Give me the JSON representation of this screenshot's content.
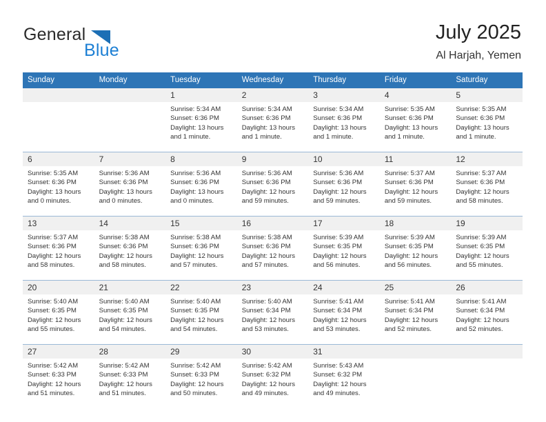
{
  "brand": {
    "name_part1": "General",
    "name_part2": "Blue",
    "triangle_color": "#1c6fb5",
    "blue_color": "#1c7fd4"
  },
  "header": {
    "title": "July 2025",
    "location": "Al Harjah, Yemen",
    "header_bg": "#2e75b6",
    "daynum_bg": "#f0f0f0"
  },
  "weekday_headers": [
    "Sunday",
    "Monday",
    "Tuesday",
    "Wednesday",
    "Thursday",
    "Friday",
    "Saturday"
  ],
  "weeks": [
    [
      {
        "day": "",
        "lines": []
      },
      {
        "day": "",
        "lines": []
      },
      {
        "day": "1",
        "lines": [
          "Sunrise: 5:34 AM",
          "Sunset: 6:36 PM",
          "Daylight: 13 hours",
          "and 1 minute."
        ]
      },
      {
        "day": "2",
        "lines": [
          "Sunrise: 5:34 AM",
          "Sunset: 6:36 PM",
          "Daylight: 13 hours",
          "and 1 minute."
        ]
      },
      {
        "day": "3",
        "lines": [
          "Sunrise: 5:34 AM",
          "Sunset: 6:36 PM",
          "Daylight: 13 hours",
          "and 1 minute."
        ]
      },
      {
        "day": "4",
        "lines": [
          "Sunrise: 5:35 AM",
          "Sunset: 6:36 PM",
          "Daylight: 13 hours",
          "and 1 minute."
        ]
      },
      {
        "day": "5",
        "lines": [
          "Sunrise: 5:35 AM",
          "Sunset: 6:36 PM",
          "Daylight: 13 hours",
          "and 1 minute."
        ]
      }
    ],
    [
      {
        "day": "6",
        "lines": [
          "Sunrise: 5:35 AM",
          "Sunset: 6:36 PM",
          "Daylight: 13 hours",
          "and 0 minutes."
        ]
      },
      {
        "day": "7",
        "lines": [
          "Sunrise: 5:36 AM",
          "Sunset: 6:36 PM",
          "Daylight: 13 hours",
          "and 0 minutes."
        ]
      },
      {
        "day": "8",
        "lines": [
          "Sunrise: 5:36 AM",
          "Sunset: 6:36 PM",
          "Daylight: 13 hours",
          "and 0 minutes."
        ]
      },
      {
        "day": "9",
        "lines": [
          "Sunrise: 5:36 AM",
          "Sunset: 6:36 PM",
          "Daylight: 12 hours",
          "and 59 minutes."
        ]
      },
      {
        "day": "10",
        "lines": [
          "Sunrise: 5:36 AM",
          "Sunset: 6:36 PM",
          "Daylight: 12 hours",
          "and 59 minutes."
        ]
      },
      {
        "day": "11",
        "lines": [
          "Sunrise: 5:37 AM",
          "Sunset: 6:36 PM",
          "Daylight: 12 hours",
          "and 59 minutes."
        ]
      },
      {
        "day": "12",
        "lines": [
          "Sunrise: 5:37 AM",
          "Sunset: 6:36 PM",
          "Daylight: 12 hours",
          "and 58 minutes."
        ]
      }
    ],
    [
      {
        "day": "13",
        "lines": [
          "Sunrise: 5:37 AM",
          "Sunset: 6:36 PM",
          "Daylight: 12 hours",
          "and 58 minutes."
        ]
      },
      {
        "day": "14",
        "lines": [
          "Sunrise: 5:38 AM",
          "Sunset: 6:36 PM",
          "Daylight: 12 hours",
          "and 58 minutes."
        ]
      },
      {
        "day": "15",
        "lines": [
          "Sunrise: 5:38 AM",
          "Sunset: 6:36 PM",
          "Daylight: 12 hours",
          "and 57 minutes."
        ]
      },
      {
        "day": "16",
        "lines": [
          "Sunrise: 5:38 AM",
          "Sunset: 6:36 PM",
          "Daylight: 12 hours",
          "and 57 minutes."
        ]
      },
      {
        "day": "17",
        "lines": [
          "Sunrise: 5:39 AM",
          "Sunset: 6:35 PM",
          "Daylight: 12 hours",
          "and 56 minutes."
        ]
      },
      {
        "day": "18",
        "lines": [
          "Sunrise: 5:39 AM",
          "Sunset: 6:35 PM",
          "Daylight: 12 hours",
          "and 56 minutes."
        ]
      },
      {
        "day": "19",
        "lines": [
          "Sunrise: 5:39 AM",
          "Sunset: 6:35 PM",
          "Daylight: 12 hours",
          "and 55 minutes."
        ]
      }
    ],
    [
      {
        "day": "20",
        "lines": [
          "Sunrise: 5:40 AM",
          "Sunset: 6:35 PM",
          "Daylight: 12 hours",
          "and 55 minutes."
        ]
      },
      {
        "day": "21",
        "lines": [
          "Sunrise: 5:40 AM",
          "Sunset: 6:35 PM",
          "Daylight: 12 hours",
          "and 54 minutes."
        ]
      },
      {
        "day": "22",
        "lines": [
          "Sunrise: 5:40 AM",
          "Sunset: 6:35 PM",
          "Daylight: 12 hours",
          "and 54 minutes."
        ]
      },
      {
        "day": "23",
        "lines": [
          "Sunrise: 5:40 AM",
          "Sunset: 6:34 PM",
          "Daylight: 12 hours",
          "and 53 minutes."
        ]
      },
      {
        "day": "24",
        "lines": [
          "Sunrise: 5:41 AM",
          "Sunset: 6:34 PM",
          "Daylight: 12 hours",
          "and 53 minutes."
        ]
      },
      {
        "day": "25",
        "lines": [
          "Sunrise: 5:41 AM",
          "Sunset: 6:34 PM",
          "Daylight: 12 hours",
          "and 52 minutes."
        ]
      },
      {
        "day": "26",
        "lines": [
          "Sunrise: 5:41 AM",
          "Sunset: 6:34 PM",
          "Daylight: 12 hours",
          "and 52 minutes."
        ]
      }
    ],
    [
      {
        "day": "27",
        "lines": [
          "Sunrise: 5:42 AM",
          "Sunset: 6:33 PM",
          "Daylight: 12 hours",
          "and 51 minutes."
        ]
      },
      {
        "day": "28",
        "lines": [
          "Sunrise: 5:42 AM",
          "Sunset: 6:33 PM",
          "Daylight: 12 hours",
          "and 51 minutes."
        ]
      },
      {
        "day": "29",
        "lines": [
          "Sunrise: 5:42 AM",
          "Sunset: 6:33 PM",
          "Daylight: 12 hours",
          "and 50 minutes."
        ]
      },
      {
        "day": "30",
        "lines": [
          "Sunrise: 5:42 AM",
          "Sunset: 6:32 PM",
          "Daylight: 12 hours",
          "and 49 minutes."
        ]
      },
      {
        "day": "31",
        "lines": [
          "Sunrise: 5:43 AM",
          "Sunset: 6:32 PM",
          "Daylight: 12 hours",
          "and 49 minutes."
        ]
      },
      {
        "day": "",
        "lines": []
      },
      {
        "day": "",
        "lines": []
      }
    ]
  ]
}
